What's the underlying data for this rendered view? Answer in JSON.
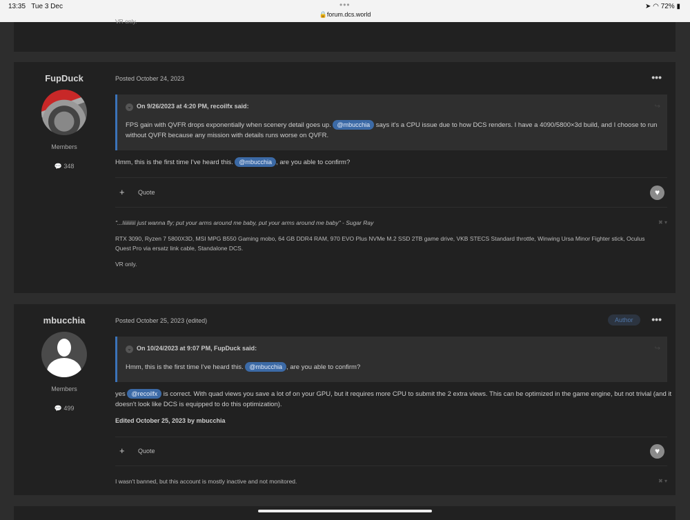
{
  "status_bar": {
    "time": "13:35",
    "date": "Tue 3 Dec",
    "url": "forum.dcs.world",
    "battery": "72%"
  },
  "prev_post": {
    "signature_tail": "VR only."
  },
  "posts": [
    {
      "author": "FupDuck",
      "role": "Members",
      "post_count": "348",
      "posted": "Posted October 24, 2023",
      "quote": {
        "header": "On 9/26/2023 at 4:20 PM, recoilfx said:",
        "before": "FPS gain with QVFR drops exponentially when scenery detail goes up. ",
        "mention": "@mbucchia",
        "after": " says it's a CPU issue due to how DCS renders. I have a 4090/5800×3d build, and I choose to run without QVFR because any mission with details runs worse on QVFR."
      },
      "body": {
        "before": "Hmm, this is the first time I've heard this. ",
        "mention": "@mbucchia",
        "after": ", are you able to confirm?"
      },
      "quote_label": "Quote",
      "signature": {
        "line1": "\"...Iiiiiiiiii just wanna fly; put your arms around me baby, put your arms around me baby\" - Sugar Ray",
        "line2": "RTX 3090, Ryzen 7 5800X3D, MSI MPG B550 Gaming mobo, 64 GB DDR4 RAM, 970 EVO Plus NVMe M.2 SSD 2TB game drive, VKB STECS Standard throttle, Winwing Ursa Minor Fighter stick, Oculus Quest Pro via ersatz link cable, Standalone DCS.",
        "line3": "VR only."
      }
    },
    {
      "author": "mbucchia",
      "role": "Members",
      "post_count": "499",
      "posted": "Posted October 25, 2023 (edited)",
      "badge": "Author",
      "quote": {
        "header": "On 10/24/2023 at 9:07 PM, FupDuck said:",
        "before": "Hmm, this is the first time I've heard this. ",
        "mention": "@mbucchia",
        "after": ", are you able to confirm?"
      },
      "body": {
        "before": "yes ",
        "mention": "@recoilfx",
        "after": " is correct. With quad views you save a lot of on your GPU, but it requires more CPU to submit the 2 extra views. This can be optimized in the game engine, but not trivial (and it doesn't look like DCS is equipped to do this optimization)."
      },
      "edited": "Edited October 25, 2023 by mbucchia",
      "quote_label": "Quote",
      "signature": {
        "line1": "I wasn't banned, but this account is mostly inactive and not monitored."
      }
    }
  ]
}
